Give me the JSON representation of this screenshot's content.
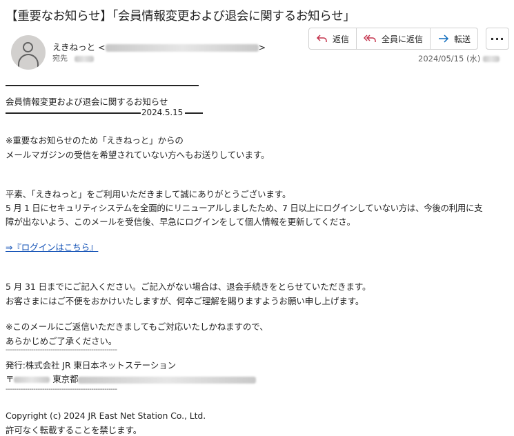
{
  "subject": "【重要なお知らせ】「会員情報変更および退会に関するお知らせ」",
  "sender": {
    "name": "えきねっと",
    "email_open": "<",
    "email_close": ">"
  },
  "recipient_label": "宛先",
  "actions": {
    "reply": "返信",
    "reply_all": "全員に返信",
    "forward": "転送",
    "more": "···"
  },
  "date": "2024/05/15 (水)",
  "body": {
    "heading": "会員情報変更および退会に関するお知らせ",
    "heading_date": "2024.5.15",
    "notice_1": "※重要なお知らせのため「えきねっと」からの",
    "notice_2": "メールマガジンの受信を希望されていない方へもお送りしています。",
    "p1_1": "平素、「えきねっと」をご利用いただきまして誠にありがとうございます。",
    "p1_2": "5 月 1 日にセキュリティシステムを全面的にリニューアルしましたため、7 日以上にログインしていない方は、今後の利用に支",
    "p1_3": "障が出ないよう、このメールを受信後、早急にログインをして個人情報を更新してくださ。",
    "login_link": "⇒『ログインはこちら』",
    "p2_1": "5 月 31 日までにご記入ください。ご記入がない場合は、退会手続きをとらせていただきます。",
    "p2_2": "お客さまにはご不便をおかけいたしますが、何卒ご理解を賜りますようお願い申し上げます。",
    "p3_1": "※このメールにご返信いただきましてもご対応いたしかねますので、",
    "p3_2": "あらかじめご了承ください。",
    "divider": "----------------------------------------------------",
    "publisher": "発行:株式会社 JR 東日本ネットステーション",
    "postal_prefix": "〒",
    "address_prefix": "東京都",
    "copyright": "Copyright (c) 2024 JR East Net Station Co., Ltd.",
    "no_reprint": "許可なく転載することを禁じます。"
  },
  "colors": {
    "link": "#0f4fb5",
    "text": "#242424",
    "muted": "#616161"
  }
}
